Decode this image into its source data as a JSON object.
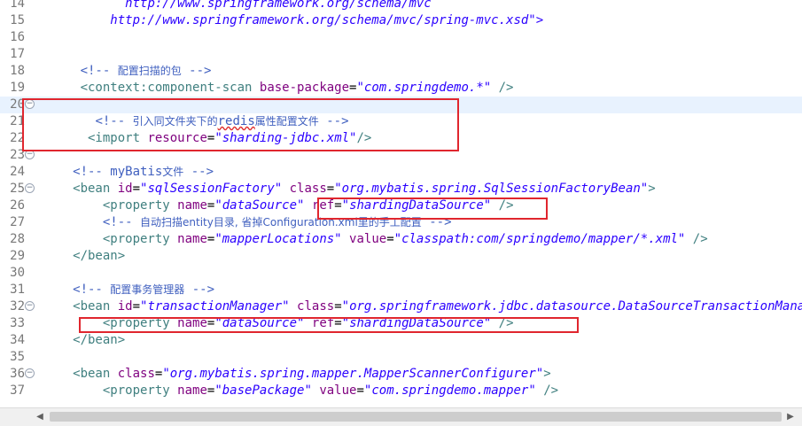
{
  "lines": [
    {
      "n": "14",
      "indent": 12,
      "t": "http://www.springframework.org/schema/mvc",
      "kind": "url"
    },
    {
      "n": "15",
      "indent": 10,
      "t": "http://www.springframework.org/schema/mvc/spring-mvc.xsd\">",
      "kind": "url"
    },
    {
      "n": "16",
      "t": ""
    },
    {
      "n": "17",
      "t": ""
    },
    {
      "n": "18",
      "indent": 6,
      "t1": "<!-- ",
      "cjk": "配置扫描的包",
      "t2": " -->",
      "kind": "comment"
    },
    {
      "n": "19",
      "indent": 6,
      "tag": "<context:component-scan",
      "attr": "base-package",
      "val": "\"com.springdemo.*\"",
      "end": " />",
      "kind": "tag"
    },
    {
      "n": "20",
      "t": "",
      "fold": true,
      "current": true
    },
    {
      "n": "21",
      "indent": 8,
      "t1": "<!-- ",
      "cjk": "引入同文件夹下的",
      "sq": "redis",
      "cjk2": "属性配置文件",
      "t2": " -->",
      "kind": "comment"
    },
    {
      "n": "22",
      "indent": 7,
      "tag": "<import",
      "attr": "resource",
      "val": "\"sharding-jdbc.xml\"",
      "end": "/>",
      "kind": "tag"
    },
    {
      "n": "23",
      "t": "",
      "fold": true
    },
    {
      "n": "24",
      "indent": 5,
      "t1": "<!-- myBatis",
      "cjk": "文件",
      "t2": " -->",
      "kind": "comment"
    },
    {
      "n": "25",
      "indent": 5,
      "fold": true,
      "tag": "<bean",
      "attr": "id",
      "val": "\"sqlSessionFactory\"",
      "attr2": "class",
      "val2": "\"org.mybatis.spring.SqlSessionFactoryBean\"",
      "end": ">",
      "kind": "tag2"
    },
    {
      "n": "26",
      "indent": 9,
      "tag": "<property",
      "attr": "name",
      "val": "\"dataSource\"",
      "attr2": "ref",
      "val2": "\"shardingDataSource\"",
      "end": " />",
      "kind": "tag2"
    },
    {
      "n": "27",
      "indent": 9,
      "t1": "<!-- ",
      "cjk": "自动扫描entity目录, 省掉Configuration.xml里的手工配置",
      "t2": " -->",
      "kind": "comment"
    },
    {
      "n": "28",
      "indent": 9,
      "tag": "<property",
      "attr": "name",
      "val": "\"mapperLocations\"",
      "attr2": "value",
      "val2": "\"classpath:com/springdemo/mapper/*.xml\"",
      "end": " />",
      "kind": "tag2"
    },
    {
      "n": "29",
      "indent": 5,
      "close": "</bean>",
      "kind": "close"
    },
    {
      "n": "30",
      "t": ""
    },
    {
      "n": "31",
      "indent": 5,
      "t1": "<!-- ",
      "cjk": "配置事务管理器",
      "t2": " -->",
      "kind": "comment"
    },
    {
      "n": "32",
      "indent": 5,
      "fold": true,
      "tag": "<bean",
      "attr": "id",
      "val": "\"transactionManager\"",
      "attr2": "class",
      "val2": "\"org.springframework.jdbc.datasource.DataSourceTransactionManager\"",
      "end": "",
      "kind": "tag2"
    },
    {
      "n": "33",
      "indent": 9,
      "tag": "<property",
      "attr": "name",
      "val": "\"dataSource\"",
      "attr2": "ref",
      "val2": "\"shardingDataSource\"",
      "end": " />",
      "kind": "tag2"
    },
    {
      "n": "34",
      "indent": 5,
      "close": "</bean>",
      "kind": "close"
    },
    {
      "n": "35",
      "t": ""
    },
    {
      "n": "36",
      "indent": 5,
      "fold": true,
      "tag": "<bean",
      "attr": "class",
      "val": "\"org.mybatis.spring.mapper.MapperScannerConfigurer\"",
      "end": ">",
      "kind": "tag"
    },
    {
      "n": "37",
      "indent": 9,
      "tag": "<property",
      "attr": "name",
      "val": "\"basePackage\"",
      "attr2": "value",
      "val2": "\"com.springdemo.mapper\"",
      "end": " />",
      "kind": "tag2"
    }
  ],
  "colors": {
    "highlight_box": "#e0262e",
    "current_line": "#e8f2fe"
  }
}
